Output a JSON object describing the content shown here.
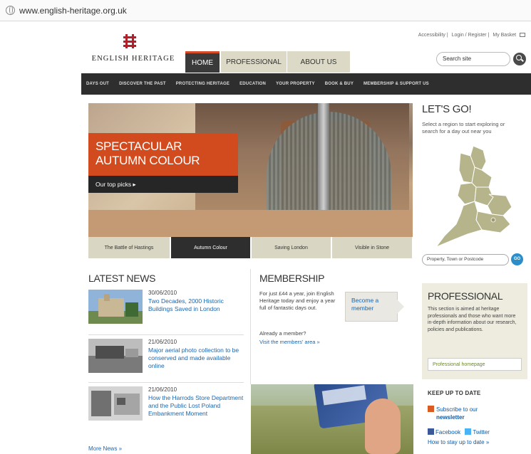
{
  "browser": {
    "url": "www.english-heritage.org.uk"
  },
  "utility_links": [
    "Accessibility",
    "Login / Register",
    "My Basket"
  ],
  "site": {
    "name": "ENGLISH HERITAGE"
  },
  "tabs": [
    {
      "label": "HOME",
      "active": true
    },
    {
      "label": "PROFESSIONAL",
      "active": false
    },
    {
      "label": "ABOUT US",
      "active": false
    }
  ],
  "search": {
    "placeholder": "Search site"
  },
  "nav": [
    "DAYS OUT",
    "DISCOVER THE PAST",
    "PROTECTING HERITAGE",
    "EDUCATION",
    "YOUR PROPERTY",
    "BOOK & BUY",
    "MEMBERSHIP & SUPPORT US"
  ],
  "hero": {
    "title_line1": "SPECTACULAR",
    "title_line2": "AUTUMN COLOUR",
    "cta": "Our top picks ▸",
    "tabs": [
      {
        "label": "The Battle of Hastings",
        "active": false
      },
      {
        "label": "Autumn Colour",
        "active": true
      },
      {
        "label": "Saving London",
        "active": false
      },
      {
        "label": "Visible in Stone",
        "active": false
      }
    ]
  },
  "letsgo": {
    "title": "LET'S GO!",
    "text": "Select a region to start exploring or search for a day out near you",
    "input_placeholder": "Property, Town or Postcode",
    "go": "GO"
  },
  "news": {
    "title": "LATEST NEWS",
    "items": [
      {
        "date": "30/06/2010",
        "title": "Two Decades, 2000 Historic Buildings Saved in London"
      },
      {
        "date": "21/06/2010",
        "title": "Major aerial photo collection to be conserved and made available online"
      },
      {
        "date": "21/06/2010",
        "title": "How the Harrods Store Department and the Public Lost Poland Embankment Moment"
      }
    ],
    "more": "More News »"
  },
  "membership": {
    "title": "MEMBERSHIP",
    "text": "For just £44 a year, join English Heritage today and enjoy a year full of fantastic days out.",
    "button": "Become a member",
    "already": "Already a member?",
    "visit": "Visit the members' area »"
  },
  "professional": {
    "title": "PROFESSIONAL",
    "text": "This section is aimed at heritage professionals and those who want more in-depth information about our research, policies and publications.",
    "button": "Professional homepage"
  },
  "keep_up": {
    "title": "KEEP UP TO DATE",
    "subscribe_text": "Subscribe to our",
    "newsletter": "newsletter",
    "facebook": "Facebook",
    "twitter": "Twitter",
    "howto": "How to stay up to date »"
  },
  "colors": {
    "accent_red": "#d24b1e",
    "nav_dark": "#2e2e2e",
    "tab_beige": "#dcdac7",
    "link_blue": "#1a66b0",
    "map_green": "#b6b48a"
  }
}
